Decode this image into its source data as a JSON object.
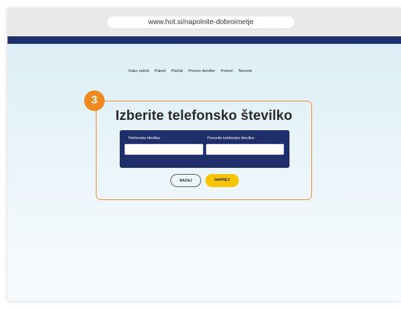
{
  "browser": {
    "url": "www.hot.si/napolnite-dobroimetje"
  },
  "nav": {
    "items": [
      {
        "label": "Kako začeti"
      },
      {
        "label": "Paketi"
      },
      {
        "label": "Plačila"
      },
      {
        "label": "Prenos številke"
      },
      {
        "label": "Pomoč"
      },
      {
        "label": "Novosti"
      }
    ]
  },
  "step": {
    "number": "3",
    "title": "Izberite telefonsko številko"
  },
  "form": {
    "phone_label": "Telefonska številka:",
    "phone_value": "",
    "repeat_label": "Ponovite telefonsko številko:",
    "repeat_value": ""
  },
  "buttons": {
    "back_label": "NAZAJ",
    "next_label": "NAPREJ"
  },
  "colors": {
    "accent": "#f08a1c",
    "navy": "#1f2f6b",
    "yellow": "#f7c600"
  }
}
